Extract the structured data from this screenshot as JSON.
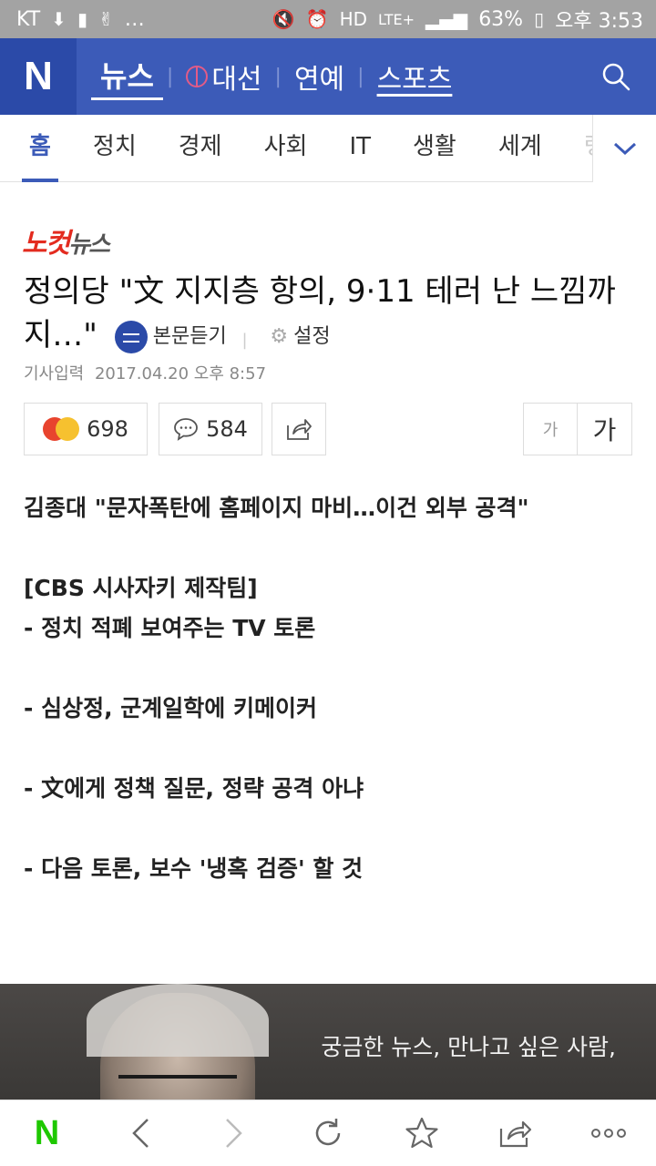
{
  "status_bar": {
    "carrier": "KT",
    "left_extra": "…",
    "battery": "63%",
    "time": "오후 3:53",
    "network": "LTE+"
  },
  "header": {
    "logo": "N",
    "nav": [
      {
        "label": "뉴스"
      },
      {
        "label": "대선"
      },
      {
        "label": "연예"
      },
      {
        "label": "스포츠"
      }
    ]
  },
  "tabs": [
    "홈",
    "정치",
    "경제",
    "사회",
    "IT",
    "생활",
    "세계",
    "랭"
  ],
  "article": {
    "press": {
      "red": "노컷",
      "gray": "뉴스"
    },
    "headline": "정의당 \"文 지지층 항의, 9·11 테러 난 느낌까지…\"",
    "listen_label": "본문듣기",
    "settings_label": "설정",
    "date_label": "기사입력",
    "date_value": "2017.04.20 오후 8:57",
    "reaction_count": "698",
    "comment_count": "584",
    "font_small": "가",
    "font_large": "가",
    "body": [
      "김종대 \"문자폭탄에 홈페이지 마비…이건 외부 공격\"",
      "",
      "[CBS 시사자키 제작팀]",
      "- 정치 적폐 보여주는 TV 토론",
      "",
      "- 심상정, 군계일학에 키메이커",
      "",
      "- 文에게 정책 질문, 정략 공격 아냐",
      "",
      "- 다음 토론, 보수 '냉혹 검증' 할 것"
    ]
  },
  "banner": {
    "text": "궁금한 뉴스, 만나고 싶은 사람,"
  },
  "bottom_bar": {
    "home": "N"
  },
  "colors": {
    "header_bg": "#3c5bb8",
    "logo_bg": "#2b4aa8",
    "active_tab": "#3c5bb8",
    "press_red": "#e32b1f",
    "naver_green": "#1ec800"
  }
}
